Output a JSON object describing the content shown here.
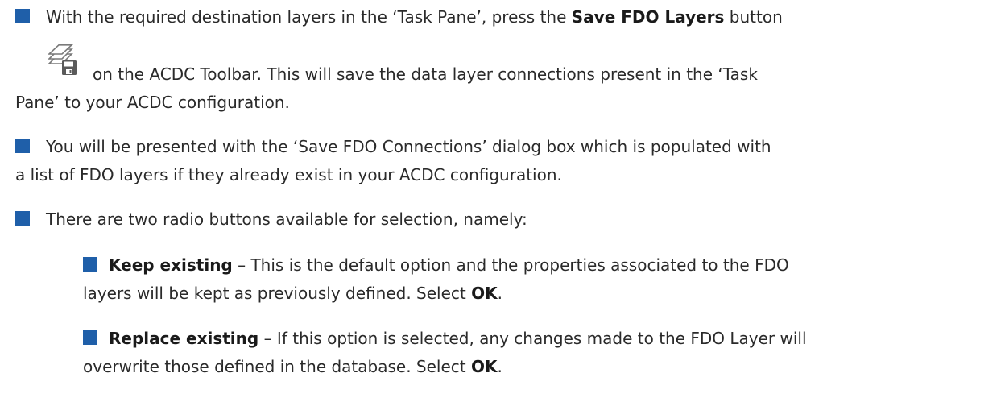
{
  "colors": {
    "bullet": "#1f5fa9",
    "text": "#2a2a2a"
  },
  "icon": "save-fdo-layers-icon",
  "b1": {
    "l1_a": "With the required destination layers in the ‘Task Pane’, press the ",
    "l1_b": "Save FDO Layers",
    "l1_c": " button",
    "l2": "on the ACDC Toolbar. This will save the data layer connections present in the ‘Task",
    "l3": "Pane’ to your ACDC configuration."
  },
  "b2": {
    "l1": "You will be presented with the ‘Save FDO Connections’ dialog box which is populated with",
    "l2": "a list of FDO layers if they already exist in your ACDC configuration."
  },
  "b3": {
    "l1": "There are two radio buttons available for selection, namely:"
  },
  "sub1": {
    "title": "Keep existing",
    "l1": " – This is the default option and the properties associated to the FDO",
    "l2_a": "layers will be kept as previously defined. Select ",
    "l2_b": "OK",
    "l2_c": "."
  },
  "sub2": {
    "title": "Replace existing",
    "l1": " – If this option is selected, any changes made to the FDO Layer will",
    "l2_a": "overwrite those defined in the database. Select ",
    "l2_b": "OK",
    "l2_c": "."
  }
}
